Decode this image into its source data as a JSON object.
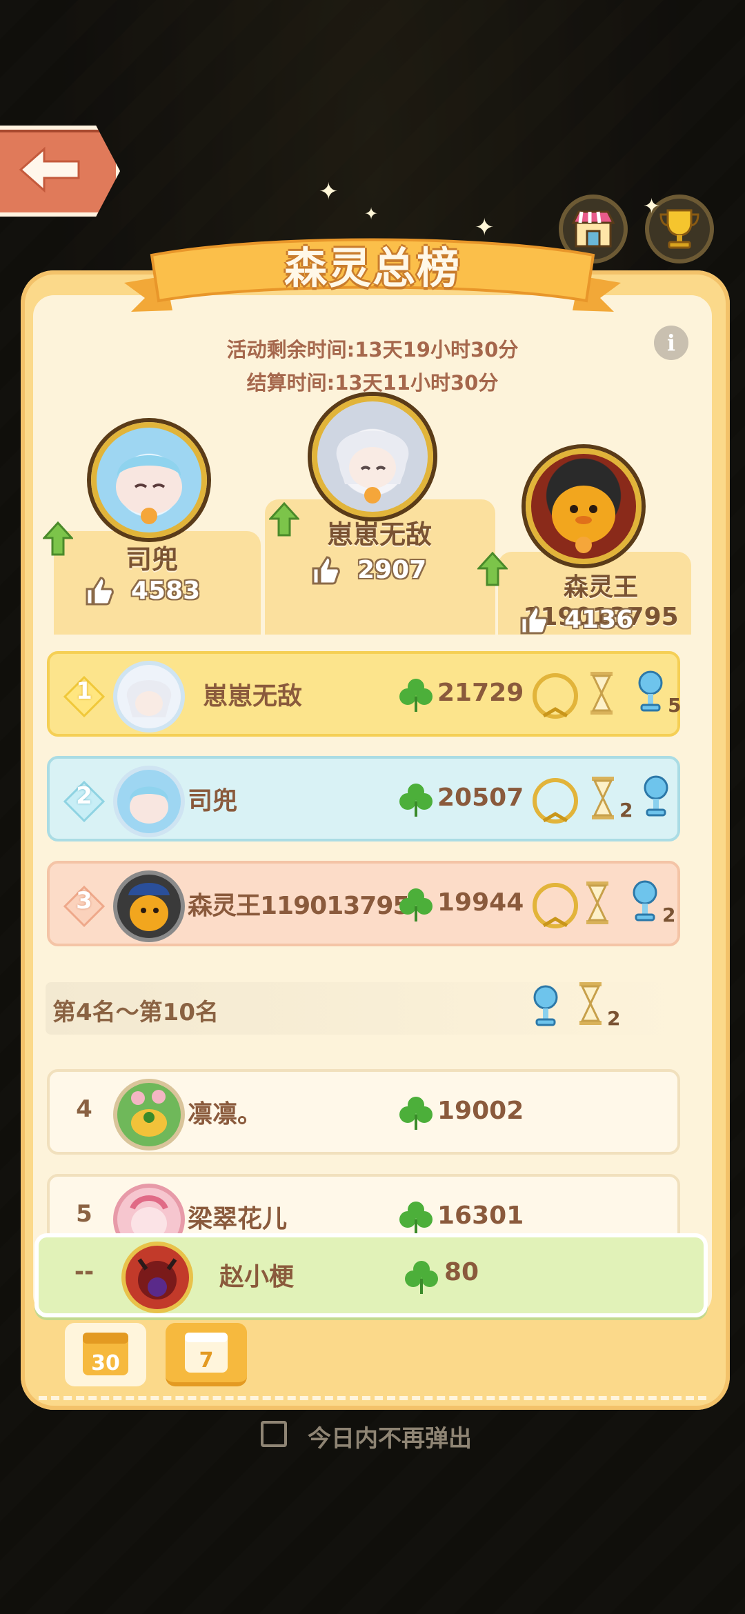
{
  "title": "森灵总榜",
  "info": {
    "remaining": "活动剩余时间:13天19小时30分",
    "settle": "结算时间:13天11小时30分",
    "info_icon": "i"
  },
  "podium": [
    {
      "place": 1,
      "name": "崽崽无敌",
      "likes": "2907"
    },
    {
      "place": 2,
      "name": "司兜",
      "likes": "4583"
    },
    {
      "place": 3,
      "name": "森灵王119013795",
      "likes": "4136"
    }
  ],
  "rankings": [
    {
      "rank": "1",
      "name": "崽崽无敌",
      "score": "21729",
      "reward_count": "5"
    },
    {
      "rank": "2",
      "name": "司兜",
      "score": "20507",
      "reward_count": "2"
    },
    {
      "rank": "3",
      "name": "森灵王119013795",
      "score": "19944",
      "reward_count": "2"
    },
    {
      "rank": "4",
      "name": "凛凛。",
      "score": "19002"
    },
    {
      "rank": "5",
      "name": "梁翠花儿",
      "score": "16301"
    }
  ],
  "section": {
    "label": "第4名～第10名",
    "reward_count": "2"
  },
  "self": {
    "rank": "--",
    "name": "赵小梗",
    "score": "80"
  },
  "tabs": {
    "active_label": "30",
    "inactive_label": "7"
  },
  "dont_show": "今日内不再弹出",
  "colors": {
    "panel": "#fbd98a",
    "clover": "#4caf3a",
    "text": "#8a5a3c"
  }
}
